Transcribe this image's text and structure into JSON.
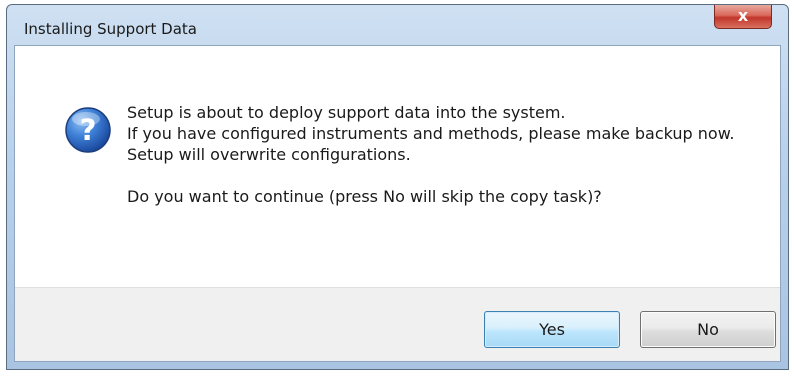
{
  "window": {
    "title": "Installing Support Data",
    "close_glyph": "x",
    "close_label": "Close"
  },
  "dialog": {
    "icon": "question-icon",
    "message_lines": [
      "Setup is about to deploy support data into the system.",
      "If you have configured instruments and methods, please make backup now.",
      "Setup will overwrite configurations."
    ],
    "question": "Do you want to continue (press No will skip the copy task)?"
  },
  "buttons": {
    "yes_label": "Yes",
    "no_label": "No"
  },
  "colors": {
    "title_bar": "#b9d1ea",
    "close_button": "#c1362a",
    "icon_blue": "#2f6fc9",
    "footer": "#f0f0f0",
    "default_button_border": "#3c7fb1"
  }
}
